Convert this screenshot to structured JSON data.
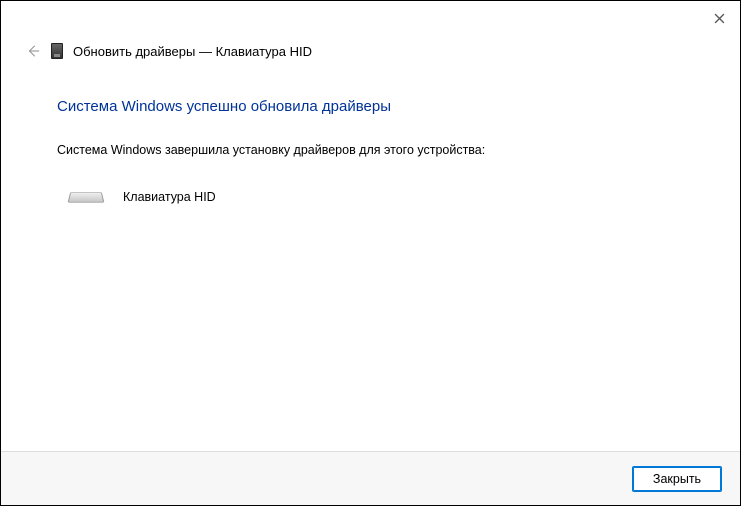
{
  "header": {
    "title": "Обновить драйверы — Клавиатура HID"
  },
  "main": {
    "heading": "Система Windows успешно обновила драйверы",
    "description": "Система Windows завершила установку драйверов для этого устройства:",
    "device_name": "Клавиатура HID"
  },
  "footer": {
    "close_label": "Закрыть"
  }
}
